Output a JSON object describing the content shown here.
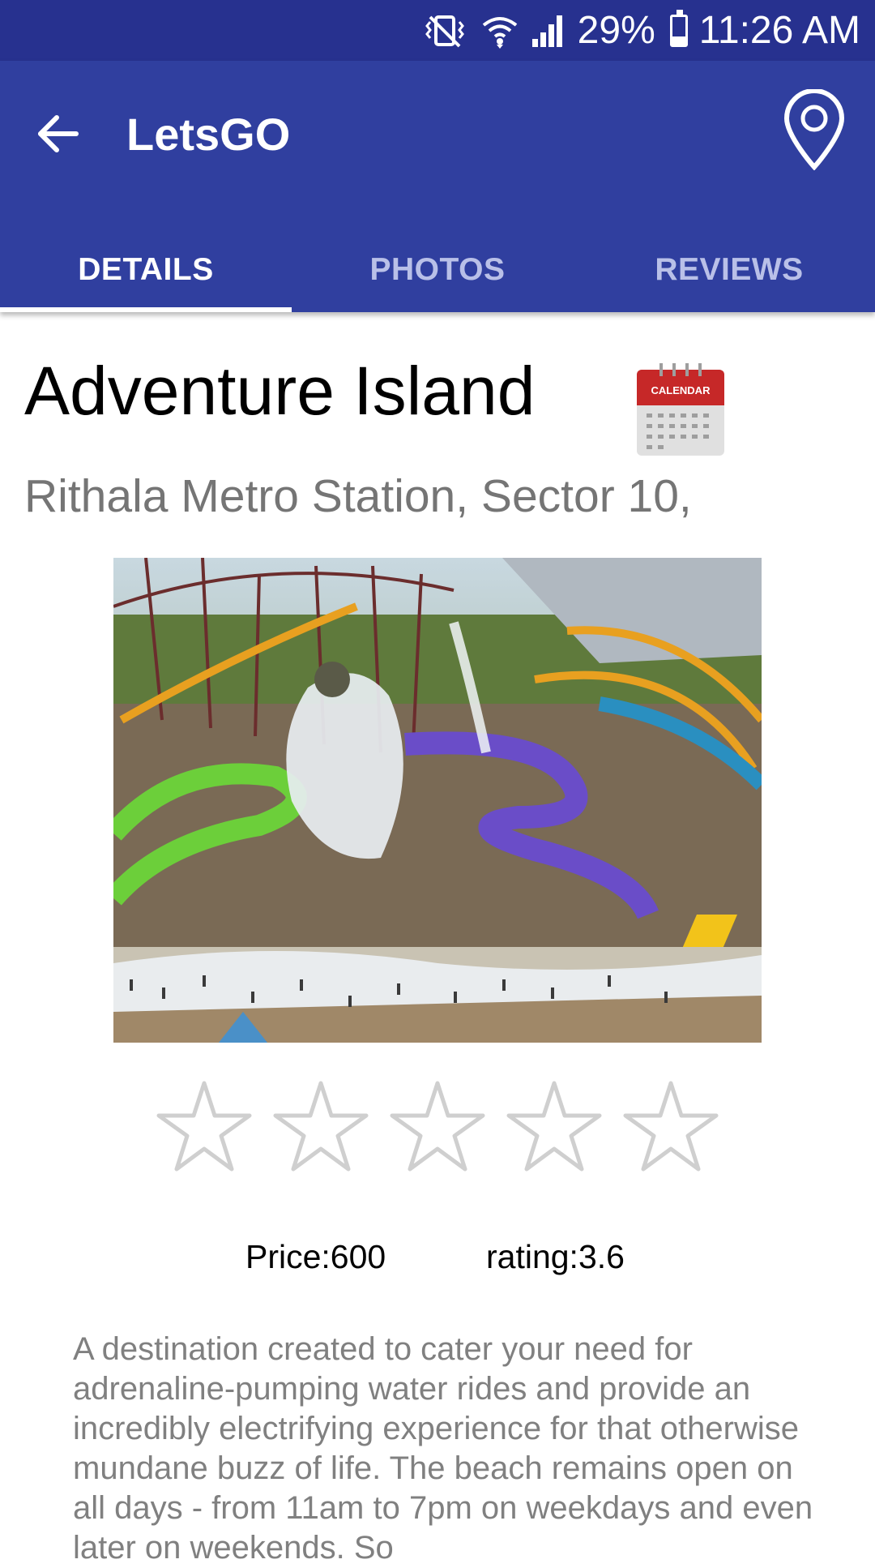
{
  "status_bar": {
    "battery": "29%",
    "time": "11:26 AM",
    "battery_level": 0.29,
    "icons": [
      "vibrate-icon",
      "wifi-icon",
      "signal-icon",
      "battery-icon"
    ]
  },
  "app_bar": {
    "title": "LetsGO",
    "back_icon": "arrow-left-icon",
    "map_icon": "map-pin-icon",
    "background": "#303f9f",
    "status_background": "#27318f"
  },
  "tabs": [
    {
      "label": "DETAILS",
      "active": true
    },
    {
      "label": "PHOTOS",
      "active": false
    },
    {
      "label": "REVIEWS",
      "active": false
    }
  ],
  "place": {
    "name": "Adventure Island",
    "address": "Rithala Metro Station, Sector 10,",
    "calendar_label": "CALENDAR",
    "image": "water-park-photo",
    "user_rating_stars": {
      "filled": 0,
      "total": 5
    },
    "price": "Price:600",
    "rating": "rating:3.6",
    "description": "A destination created to cater your need for adrenaline-pumping water rides and provide an incredibly electrifying experience for that otherwise mundane buzz of life. The beach remains open on all days - from 11am to 7pm on weekdays and even later on weekends. So"
  }
}
